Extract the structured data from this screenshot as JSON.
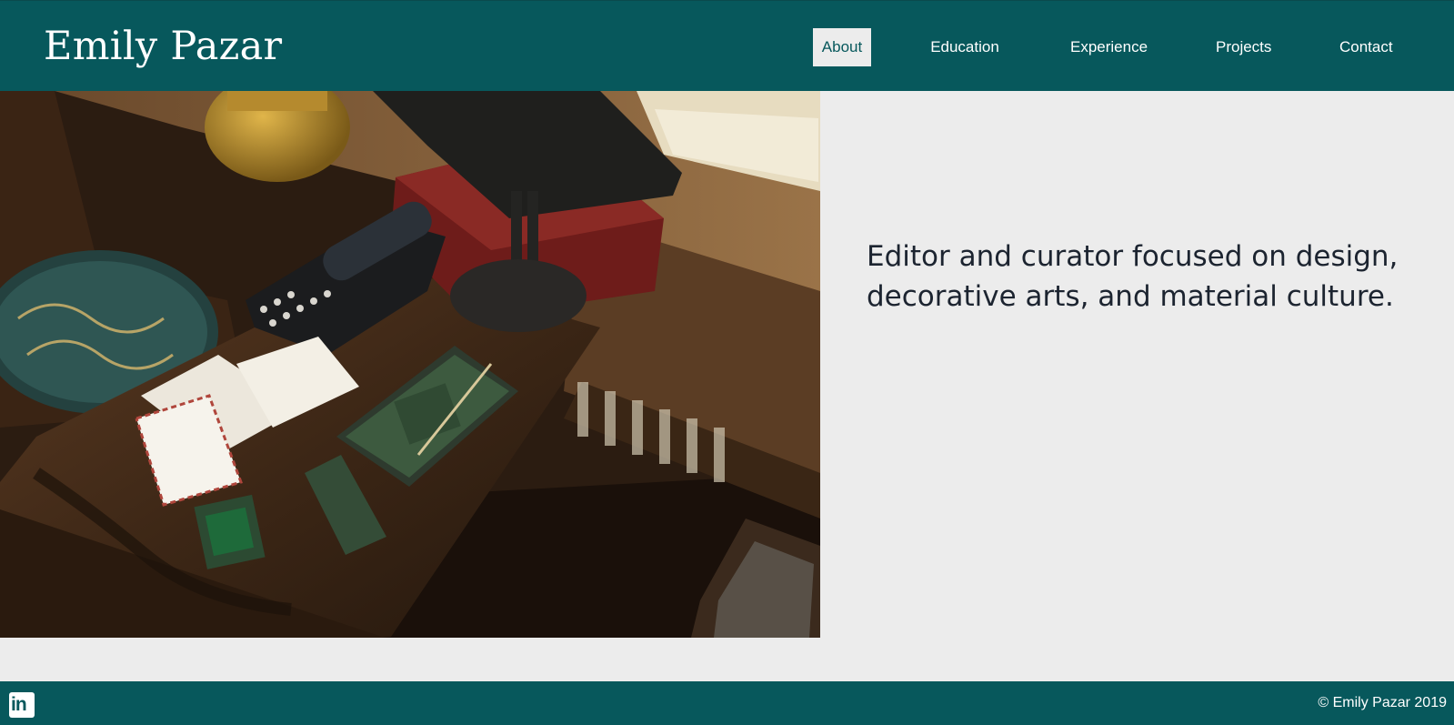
{
  "header": {
    "site_title": "Emily Pazar",
    "nav": [
      {
        "label": "About",
        "active": true
      },
      {
        "label": "Education",
        "active": false
      },
      {
        "label": "Experience",
        "active": false
      },
      {
        "label": "Projects",
        "active": false
      },
      {
        "label": "Contact",
        "active": false
      }
    ]
  },
  "hero": {
    "tagline": "Editor and curator focused on design, decorative arts, and material culture."
  },
  "footer": {
    "social_icon": "linkedin-icon",
    "social_glyph": "in",
    "copyright": "© Emily Pazar 2019"
  },
  "colors": {
    "brand": "#07585c",
    "background": "#ececec",
    "text": "#1c2430"
  }
}
